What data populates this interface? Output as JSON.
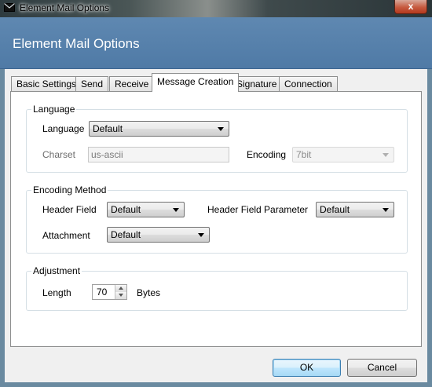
{
  "window": {
    "title": "Element Mail Options",
    "close_glyph": "x",
    "icon": "envelope-icon"
  },
  "header": {
    "heading": "Element Mail Options"
  },
  "tabs": [
    {
      "label": "Basic Settings"
    },
    {
      "label": "Send"
    },
    {
      "label": "Receive"
    },
    {
      "label": "Message Creation",
      "active": true
    },
    {
      "label": "Signature"
    },
    {
      "label": "Connection"
    }
  ],
  "language": {
    "group_title": "Language",
    "language_label": "Language",
    "language_value": "Default",
    "charset_label": "Charset",
    "charset_value": "us-ascii",
    "encoding_label": "Encoding",
    "encoding_value": "7bit"
  },
  "encoding_method": {
    "group_title": "Encoding Method",
    "header_field_label": "Header Field",
    "header_field_value": "Default",
    "header_param_label": "Header Field Parameter",
    "header_param_value": "Default",
    "attachment_label": "Attachment",
    "attachment_value": "Default"
  },
  "adjustment": {
    "group_title": "Adjustment",
    "length_label": "Length",
    "length_value": "70",
    "unit_label": "Bytes"
  },
  "buttons": {
    "ok": "OK",
    "cancel": "Cancel"
  }
}
